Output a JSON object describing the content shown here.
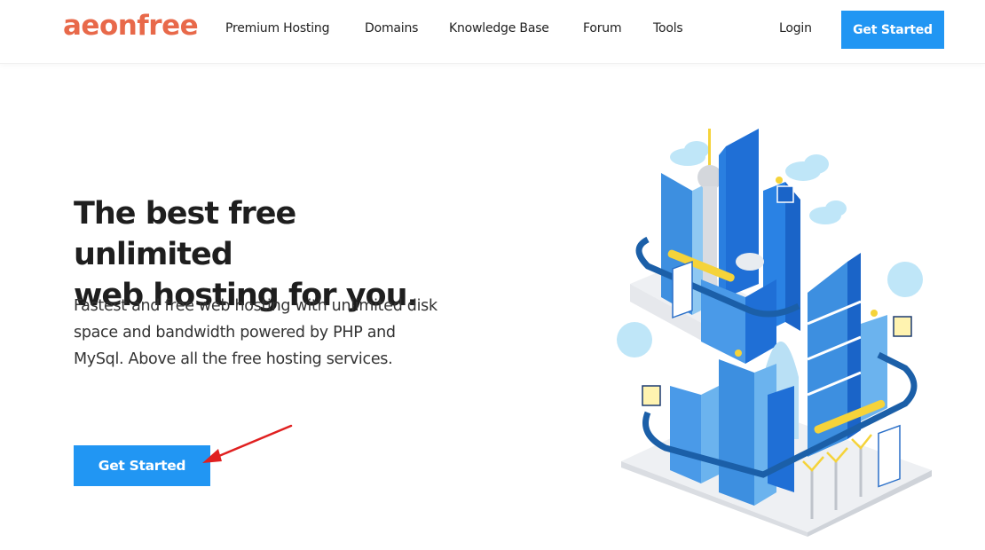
{
  "brand": {
    "logo_text": "aeonfree",
    "logo_color": "#e8694a"
  },
  "nav": {
    "items": [
      {
        "label": "Premium Hosting"
      },
      {
        "label": "Domains"
      },
      {
        "label": "Knowledge Base"
      },
      {
        "label": "Forum"
      },
      {
        "label": "Tools"
      }
    ],
    "login_label": "Login",
    "cta_label": "Get Started"
  },
  "hero": {
    "title_line1": "The best free unlimited",
    "title_line2": "web hosting for you.",
    "description": "Fastest and free web hosting with unlimited disk space and bandwidth powered by PHP and MySql. Above all the free hosting services.",
    "cta_label": "Get Started"
  },
  "annotation": {
    "arrow_color": "#e02020",
    "points_to": "hero-get-started-button"
  },
  "colors": {
    "accent": "#2196f3",
    "brand": "#e8694a",
    "text": "#1e1e1e"
  },
  "illustration": {
    "subject": "isometric smart city with skyscrapers, monorail, wind turbines and solar panels"
  }
}
